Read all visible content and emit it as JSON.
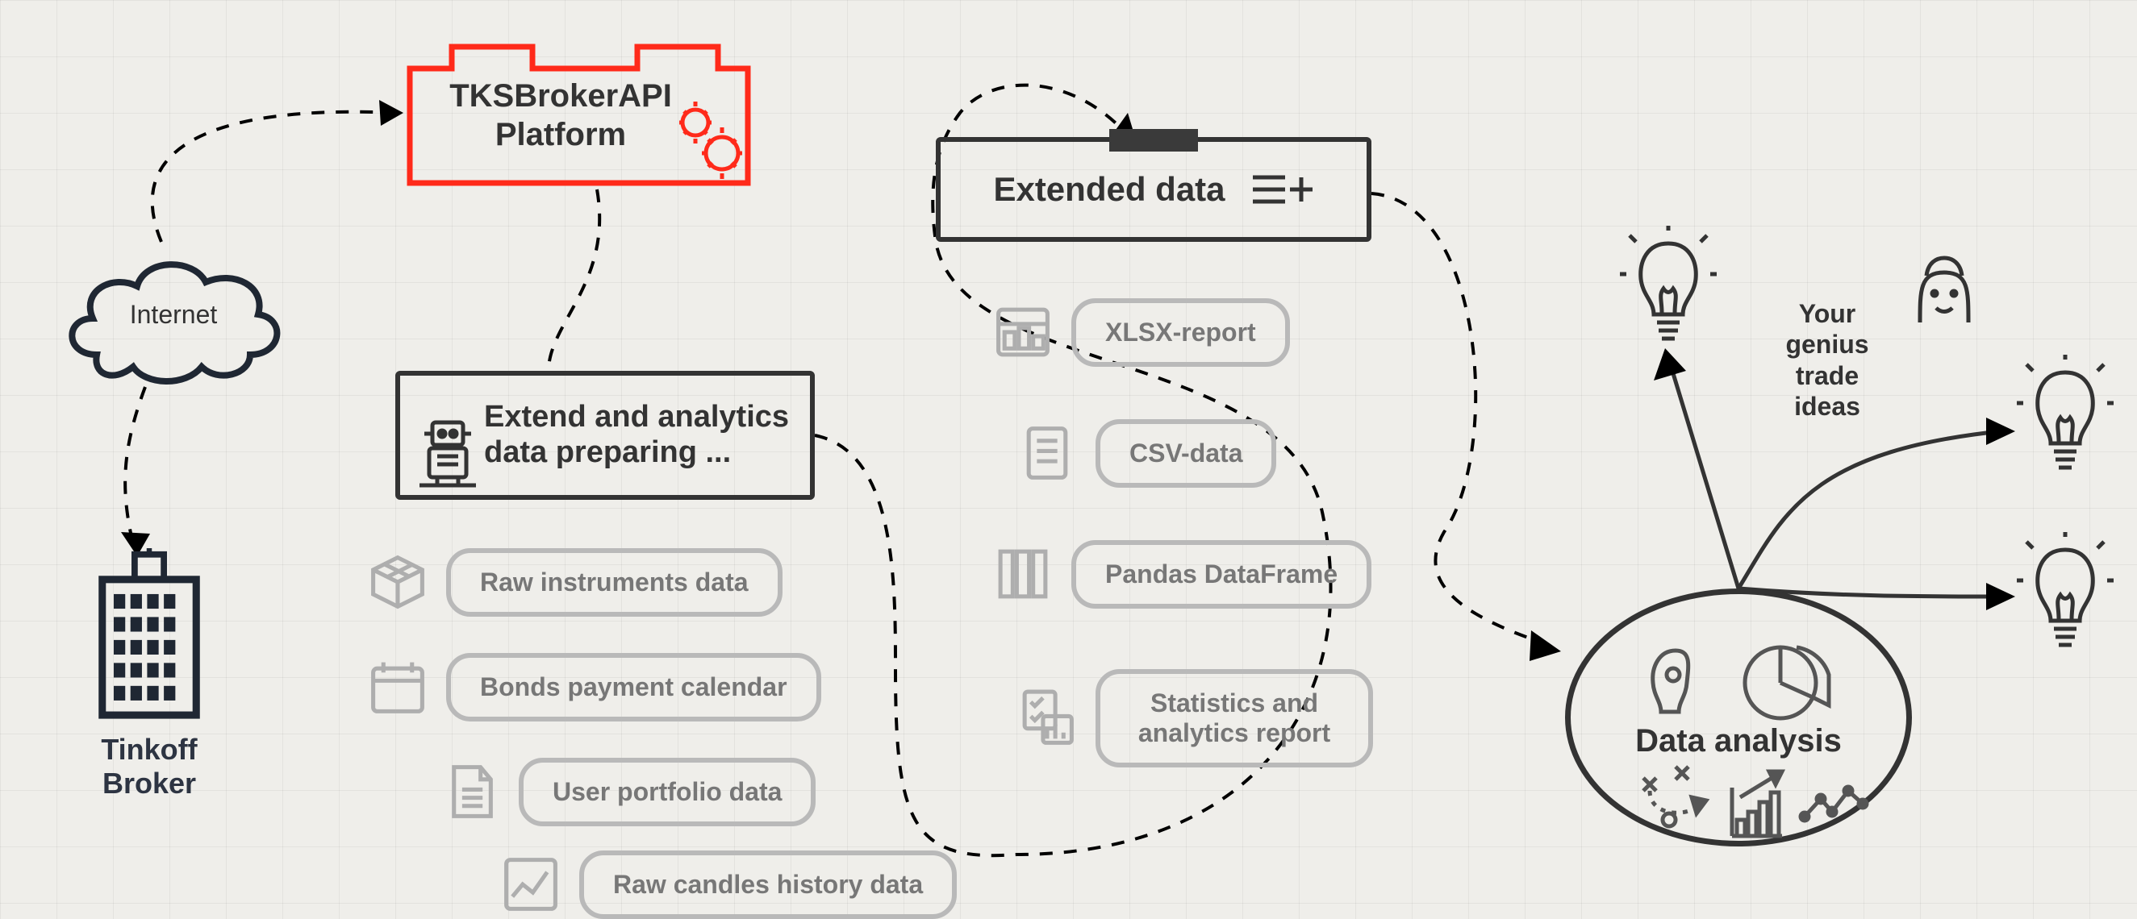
{
  "internet": {
    "label": "Internet"
  },
  "broker": {
    "label": "Tinkoff Broker"
  },
  "platform": {
    "title_line1": "TKSBrokerAPI",
    "title_line2": "Platform"
  },
  "extend_box": {
    "title_line1": "Extend and analytics",
    "title_line2": "data preparing ..."
  },
  "extended_box": {
    "title": "Extended data"
  },
  "analytics_items": {
    "raw_instruments": "Raw instruments data",
    "bonds_calendar": "Bonds payment calendar",
    "portfolio": "User portfolio data",
    "candles_history": "Raw candles history data"
  },
  "extended_items": {
    "xlsx": "XLSX-report",
    "csv": "CSV-data",
    "pandas": "Pandas DataFrame",
    "stats_line1": "Statistics and",
    "stats_line2": "analytics report"
  },
  "analysis": {
    "title": "Data analysis"
  },
  "genius": {
    "line1": "Your",
    "line2": "genius",
    "line3": "trade",
    "line4": "ideas"
  }
}
